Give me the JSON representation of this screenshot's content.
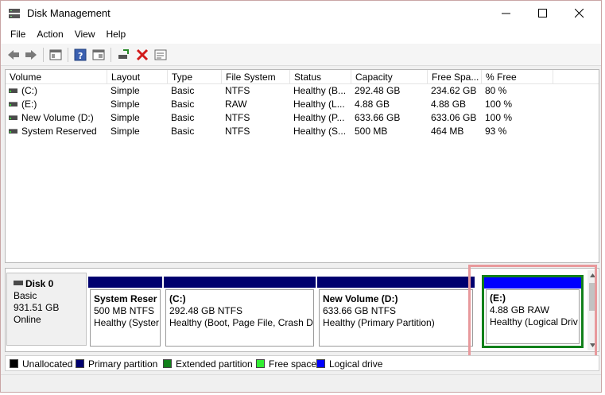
{
  "window": {
    "title": "Disk Management"
  },
  "menu": [
    "File",
    "Action",
    "View",
    "Help"
  ],
  "toolbar": {
    "icons": [
      "back-arrow-icon",
      "forward-arrow-icon",
      "console-tree-icon",
      "help-icon",
      "properties-icon",
      "connect-icon",
      "delete-icon",
      "settings-icon"
    ]
  },
  "volume_table": {
    "columns": [
      "Volume",
      "Layout",
      "Type",
      "File System",
      "Status",
      "Capacity",
      "Free Spa...",
      "% Free"
    ],
    "rows": [
      [
        "(C:)",
        "Simple",
        "Basic",
        "NTFS",
        "Healthy (B...",
        "292.48 GB",
        "234.62 GB",
        "80 %"
      ],
      [
        "(E:)",
        "Simple",
        "Basic",
        "RAW",
        "Healthy (L...",
        "4.88 GB",
        "4.88 GB",
        "100 %"
      ],
      [
        "New Volume (D:)",
        "Simple",
        "Basic",
        "NTFS",
        "Healthy (P...",
        "633.66 GB",
        "633.06 GB",
        "100 %"
      ],
      [
        "System Reserved",
        "Simple",
        "Basic",
        "NTFS",
        "Healthy (S...",
        "500 MB",
        "464 MB",
        "93 %"
      ]
    ]
  },
  "disk": {
    "name": "Disk 0",
    "type": "Basic",
    "size": "931.51 GB",
    "state": "Online"
  },
  "partitions": [
    {
      "name": "System Reser",
      "detail": "500 MB NTFS",
      "status": "Healthy (Syster"
    },
    {
      "name": "(C:)",
      "detail": "292.48 GB NTFS",
      "status": "Healthy (Boot, Page File, Crash Du"
    },
    {
      "name": "New Volume  (D:)",
      "detail": "633.66 GB NTFS",
      "status": "Healthy (Primary Partition)"
    },
    {
      "name": "(E:)",
      "detail": "4.88 GB RAW",
      "status": "Healthy (Logical Driv"
    }
  ],
  "legend": [
    {
      "label": "Unallocated",
      "color": "#000000"
    },
    {
      "label": "Primary partition",
      "color": "#00006f"
    },
    {
      "label": "Extended partition",
      "color": "#11801a"
    },
    {
      "label": "Free space",
      "color": "#33ee33"
    },
    {
      "label": "Logical drive",
      "color": "#0000ff"
    }
  ]
}
